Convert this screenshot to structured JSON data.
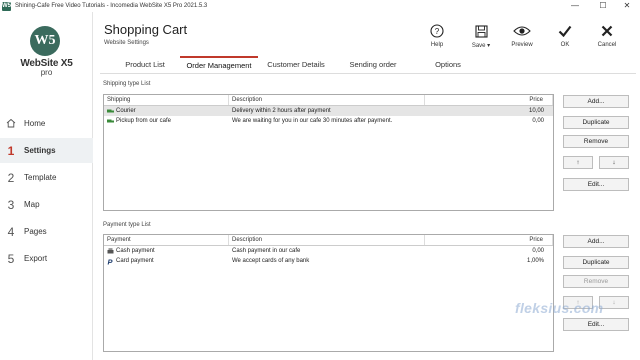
{
  "window": {
    "title": "Shining-Cafe Free Video Tutorials - Incomedia WebSite X5 Pro 2021.5.3",
    "app_icon": "W5"
  },
  "logo": {
    "mark": "W5",
    "name": "WebSite X5",
    "edition": "pro"
  },
  "sidebar": {
    "items": [
      {
        "num": "",
        "label": "Home",
        "icon": "home-icon"
      },
      {
        "num": "1",
        "label": "Settings",
        "active": true
      },
      {
        "num": "2",
        "label": "Template"
      },
      {
        "num": "3",
        "label": "Map"
      },
      {
        "num": "4",
        "label": "Pages"
      },
      {
        "num": "5",
        "label": "Export"
      }
    ]
  },
  "header": {
    "title": "Shopping Cart",
    "subtitle": "Website Settings"
  },
  "toolbar": {
    "help": "Help",
    "save": "Save",
    "preview": "Preview",
    "ok": "OK",
    "cancel": "Cancel"
  },
  "tabs": [
    {
      "label": "Product List"
    },
    {
      "label": "Order Management",
      "active": true
    },
    {
      "label": "Customer Details"
    },
    {
      "label": "Sending order"
    },
    {
      "label": "Options"
    }
  ],
  "shipping": {
    "section_label": "Shipping type List",
    "columns": [
      "Shipping",
      "Description",
      "Price"
    ],
    "rows": [
      {
        "name": "Courier",
        "description": "Delivery within 2 hours after payment",
        "price": "10,00",
        "selected": true
      },
      {
        "name": "Pickup from our cafe",
        "description": "We are waiting for you in our cafe 30 minutes after payment.",
        "price": "0,00"
      }
    ],
    "buttons": {
      "add": "Add...",
      "duplicate": "Duplicate",
      "remove": "Remove",
      "up": "↑",
      "down": "↓",
      "edit": "Edit..."
    }
  },
  "payment": {
    "section_label": "Payment type List",
    "columns": [
      "Payment",
      "Description",
      "Price"
    ],
    "rows": [
      {
        "name": "Cash payment",
        "description": "Cash payment in our cafe",
        "price": "0,00"
      },
      {
        "name": "Card payment",
        "description": "We accept cards of any bank",
        "price": "1,00%"
      }
    ],
    "buttons": {
      "add": "Add...",
      "duplicate": "Duplicate",
      "remove": "Remove",
      "up": "↑",
      "down": "↓",
      "edit": "Edit..."
    }
  },
  "watermark": "fleksius.com",
  "colors": {
    "accent": "#c0392b",
    "logo": "#3b6b5e"
  }
}
